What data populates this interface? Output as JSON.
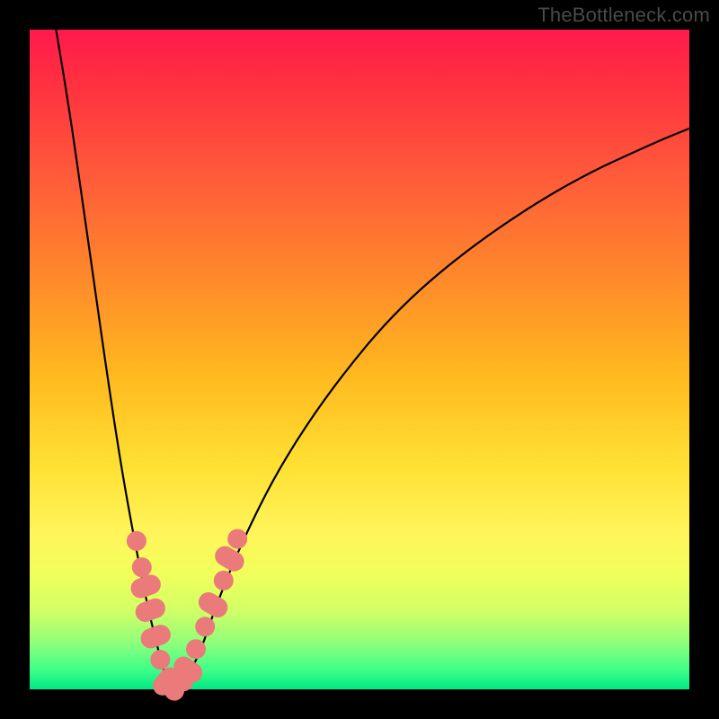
{
  "watermark": "TheBottleneck.com",
  "colors": {
    "dot": "#eb7a7a",
    "curve": "#000000",
    "frame": "#000000"
  },
  "chart_data": {
    "type": "line",
    "title": "",
    "xlabel": "",
    "ylabel": "",
    "xlim": [
      0,
      100
    ],
    "ylim": [
      0,
      100
    ],
    "grid": false,
    "series": [
      {
        "name": "bottleneck-curve",
        "x": [
          4,
          6,
          8,
          10,
          12,
          14,
          16,
          18,
          19,
          20,
          21,
          22,
          23,
          24,
          26,
          28,
          32,
          38,
          46,
          56,
          68,
          82,
          95,
          100
        ],
        "y": [
          100,
          88,
          74,
          60,
          46,
          33,
          22,
          12,
          8,
          4,
          1,
          0,
          0,
          2,
          6,
          12,
          22,
          34,
          46,
          58,
          68,
          77,
          83,
          85
        ]
      }
    ],
    "markers": [
      {
        "x": 16.2,
        "y": 22.5,
        "shape": "dot"
      },
      {
        "x": 17.0,
        "y": 18.5,
        "shape": "dot"
      },
      {
        "x": 17.6,
        "y": 15.6,
        "shape": "capsule",
        "angle": 70
      },
      {
        "x": 18.3,
        "y": 12.0,
        "shape": "capsule",
        "angle": 70
      },
      {
        "x": 19.1,
        "y": 8.0,
        "shape": "capsule",
        "angle": 70
      },
      {
        "x": 19.8,
        "y": 4.5,
        "shape": "dot"
      },
      {
        "x": 20.7,
        "y": 1.2,
        "shape": "capsule",
        "angle": 40
      },
      {
        "x": 22.0,
        "y": 0.6,
        "shape": "capsule",
        "angle": 5
      },
      {
        "x": 23.3,
        "y": 1.2,
        "shape": "dot"
      },
      {
        "x": 24.0,
        "y": 3.0,
        "shape": "capsule",
        "angle": -55
      },
      {
        "x": 25.2,
        "y": 6.1,
        "shape": "dot"
      },
      {
        "x": 26.6,
        "y": 9.5,
        "shape": "dot"
      },
      {
        "x": 27.8,
        "y": 12.8,
        "shape": "capsule",
        "angle": -60
      },
      {
        "x": 29.4,
        "y": 16.5,
        "shape": "dot"
      },
      {
        "x": 30.3,
        "y": 19.8,
        "shape": "capsule",
        "angle": -60
      },
      {
        "x": 31.5,
        "y": 22.8,
        "shape": "dot"
      }
    ]
  }
}
